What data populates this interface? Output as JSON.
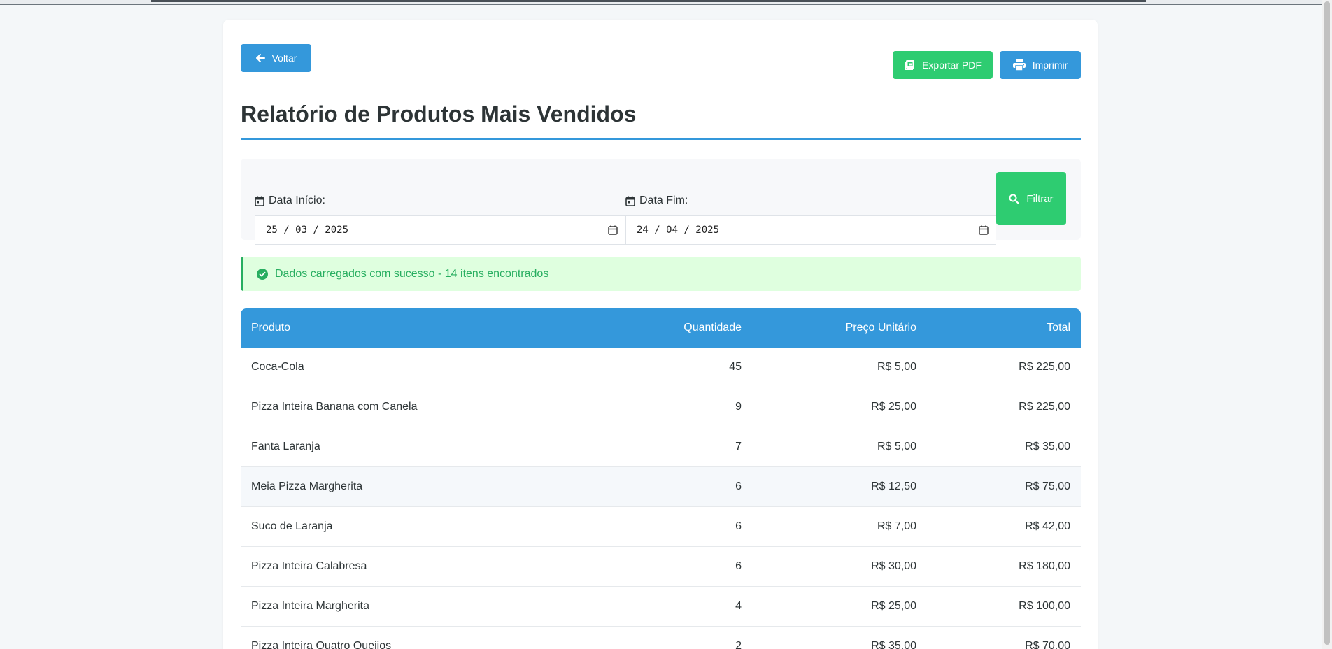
{
  "header": {
    "back_label": "Voltar",
    "export_pdf_label": "Exportar PDF",
    "print_label": "Imprimir",
    "title": "Relatório de Produtos Mais Vendidos"
  },
  "filters": {
    "start_label": "Data Início:",
    "start_value": "25 / 03 / 2025",
    "end_label": "Data Fim:",
    "end_value": "24 / 04 / 2025",
    "filter_label": "Filtrar"
  },
  "alert": {
    "message": "Dados carregados com sucesso - 14 itens encontrados"
  },
  "table": {
    "headers": [
      "Produto",
      "Quantidade",
      "Preço Unitário",
      "Total"
    ],
    "rows": [
      [
        "Coca-Cola",
        "45",
        "R$ 5,00",
        "R$ 225,00"
      ],
      [
        "Pizza Inteira Banana com Canela",
        "9",
        "R$ 25,00",
        "R$ 225,00"
      ],
      [
        "Fanta Laranja",
        "7",
        "R$ 5,00",
        "R$ 35,00"
      ],
      [
        "Meia Pizza Margherita",
        "6",
        "R$ 12,50",
        "R$ 75,00"
      ],
      [
        "Suco de Laranja",
        "6",
        "R$ 7,00",
        "R$ 42,00"
      ],
      [
        "Pizza Inteira Calabresa",
        "6",
        "R$ 30,00",
        "R$ 180,00"
      ],
      [
        "Pizza Inteira Margherita",
        "4",
        "R$ 25,00",
        "R$ 100,00"
      ],
      [
        "Pizza Inteira Quatro Queijos",
        "2",
        "R$ 35,00",
        "R$ 70,00"
      ]
    ]
  },
  "colors": {
    "primary": "#3498db",
    "success": "#2ecc71",
    "success_text": "#27ae60",
    "alert_bg": "#dfffdf"
  },
  "icons": [
    "arrow-left-icon",
    "pdf-icon",
    "printer-icon",
    "calendar-icon",
    "search-icon",
    "check-circle-icon"
  ]
}
